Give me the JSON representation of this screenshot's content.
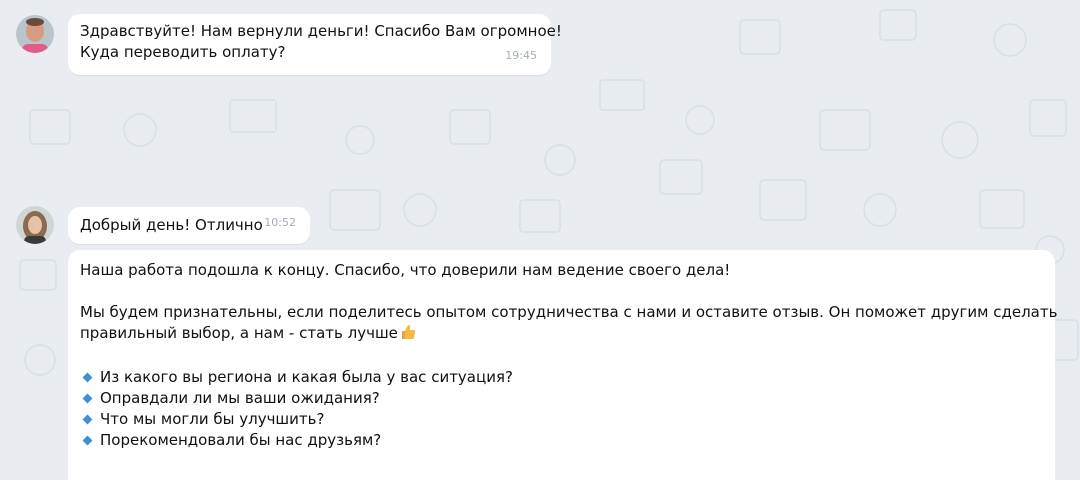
{
  "messages": [
    {
      "lines": [
        "Здравствуйте! Нам вернули деньги! Спасибо Вам огромное!",
        "Куда переводить оплату?"
      ],
      "time": "19:45"
    },
    {
      "lines": [
        "Добрый день! Отлично"
      ],
      "time": "10:52"
    },
    {
      "line1": "Наша работа подошла к концу. Спасибо, что доверили нам ведение своего дела!",
      "para2_line1": "Мы будем признательны, если поделитесь опытом сотрудничества с нами и оставите отзыв. Он поможет другим сделать",
      "para2_line2": "правильный выбор, а нам - стать лучше",
      "emoji": "thumbs-up",
      "questions": [
        "Из какого вы региона и какая была у вас ситуация?",
        "Оправдали ли мы ваши ожидания?",
        "Что мы могли бы улучшить?",
        "Порекомендовали бы нас друзьям?"
      ]
    }
  ],
  "colors": {
    "background": "#e9edf1",
    "bubble": "#ffffff",
    "timestamp": "#a3adb7",
    "bullet": "#3d8fd9"
  }
}
